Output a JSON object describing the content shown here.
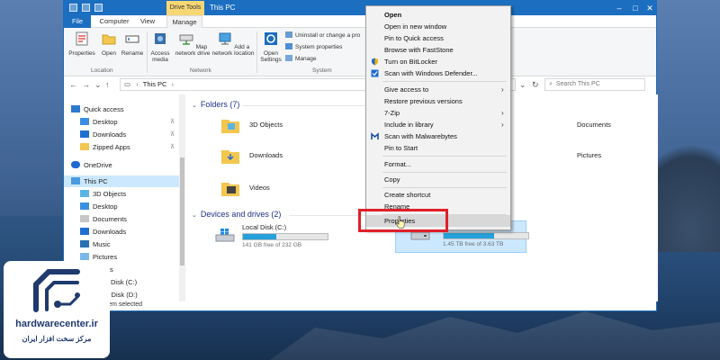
{
  "window": {
    "title": "This PC",
    "drive_tools": "Drive Tools",
    "tabs": [
      "File",
      "Computer",
      "View",
      "Manage"
    ]
  },
  "ribbon": {
    "location": {
      "label": "Location",
      "buttons": [
        "Properties",
        "Open",
        "Rename"
      ]
    },
    "network": {
      "label": "Network",
      "buttons": [
        "Access media",
        "Map network drive",
        "Add a network location"
      ]
    },
    "system": {
      "label": "System",
      "open_settings": "Open Settings",
      "items": [
        "Uninstall or change a pro",
        "System properties",
        "Manage"
      ]
    }
  },
  "address": {
    "path_root": "This PC",
    "search_placeholder": "Search This PC"
  },
  "nav": {
    "quick_access": "Quick access",
    "quick_items": [
      "Desktop",
      "Downloads",
      "Zipped Apps"
    ],
    "onedrive": "OneDrive",
    "this_pc": "This PC",
    "pc_items": [
      "3D Objects",
      "Desktop",
      "Documents",
      "Downloads",
      "Music",
      "Pictures",
      "Videos",
      "Local Disk (C:)",
      "DATA Disk (D:)"
    ]
  },
  "content": {
    "folders_header": "Folders (7)",
    "folders": [
      "3D Objects",
      "Downloads",
      "Videos",
      "Documents",
      "Pictures"
    ],
    "devices_header": "Devices and drives (2)",
    "drives": [
      {
        "name": "Local Disk (C:)",
        "free": "141 GB free of 232 GB",
        "used_fraction": 0.39
      },
      {
        "name": "",
        "free": "1.45 TB free of 3.63 TB",
        "used_fraction": 0.6
      }
    ]
  },
  "status": {
    "selected": "1 item selected"
  },
  "context_menu": {
    "items": [
      "Open",
      "Open in new window",
      "Pin to Quick access",
      "Browse with FastStone",
      "Turn on BitLocker",
      "Scan with Windows Defender...",
      "Give access to",
      "Restore previous versions",
      "7-Zip",
      "Include in library",
      "Scan with Malwarebytes",
      "Pin to Start",
      "Format...",
      "Copy",
      "Create shortcut",
      "Rename",
      "Properties"
    ]
  },
  "watermark": {
    "site": "hardwarecenter.ir",
    "tagline": "مرکز سخت افزار ایران"
  },
  "colors": {
    "titlebar": "#1c6ec0",
    "drive_bar": "#26a0da",
    "highlight": "#e0202a",
    "selection": "#cce8ff"
  }
}
